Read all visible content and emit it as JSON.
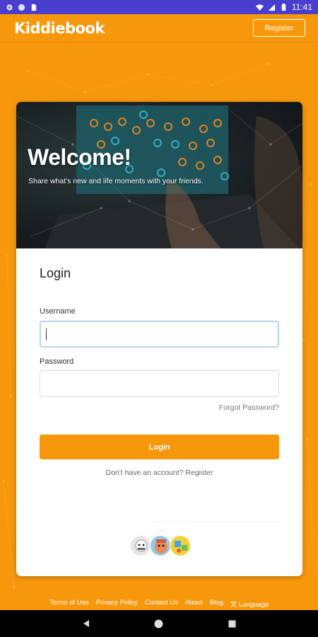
{
  "status_bar": {
    "time": "11:41",
    "icons": [
      "gear-icon",
      "circle-icon",
      "sim-icon",
      "wifi-icon",
      "cellular-icon",
      "battery-icon"
    ]
  },
  "header": {
    "logo": "Kiddiebook",
    "register_label": "Register"
  },
  "hero": {
    "title": "Welcome!",
    "subtitle": "Share what's new and life moments with your friends."
  },
  "login": {
    "title": "Login",
    "username_label": "Username",
    "username_value": "",
    "password_label": "Password",
    "password_value": "",
    "forgot_label": "Forgot Password?",
    "submit_label": "Login",
    "no_account_text": "Don't have an account? Register"
  },
  "footer": {
    "links": [
      "Terms of Use",
      "Privacy Policy",
      "Contact Us",
      "About",
      "Blog"
    ],
    "language_label": "Language"
  },
  "colors": {
    "brand": "#f7980c",
    "status_bar": "#4a3ecf",
    "focus_border": "#b7d6ec"
  }
}
